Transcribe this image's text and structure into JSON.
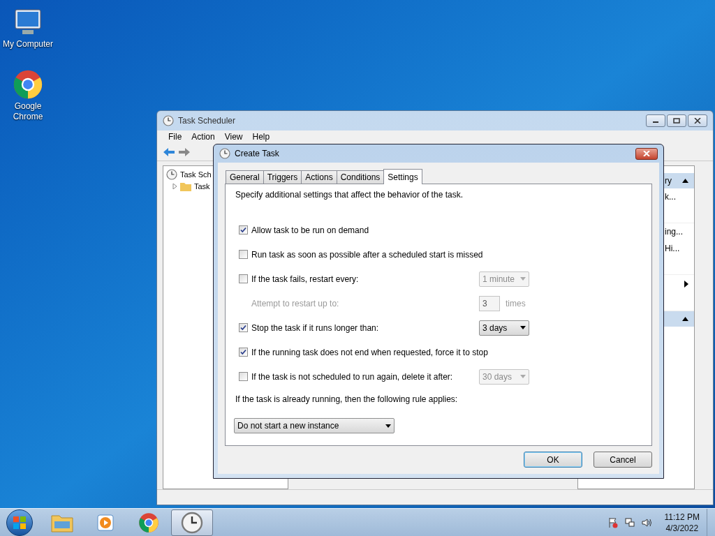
{
  "desktop_icons": [
    {
      "kind": "computer",
      "label": "My Computer"
    },
    {
      "kind": "chrome",
      "label": "Google Chrome"
    }
  ],
  "main_window": {
    "title": "Task Scheduler",
    "menu": [
      "File",
      "Action",
      "View",
      "Help"
    ],
    "tree": [
      {
        "label": "Task Sch",
        "expanded": true,
        "children": [
          {
            "label": "Task",
            "expanded": false
          }
        ]
      }
    ],
    "actions_pane": [
      {
        "kind": "header",
        "label": "ry"
      },
      {
        "kind": "item",
        "label": "k..."
      },
      {
        "kind": "gap"
      },
      {
        "kind": "item",
        "label": "ing..."
      },
      {
        "kind": "item",
        "label": "Hi..."
      },
      {
        "kind": "gap"
      },
      {
        "kind": "submenu"
      },
      {
        "kind": "gap"
      },
      {
        "kind": "header"
      }
    ]
  },
  "dialog": {
    "title": "Create Task",
    "tabs": [
      {
        "label": "General",
        "selected": false
      },
      {
        "label": "Triggers",
        "selected": false
      },
      {
        "label": "Actions",
        "selected": false
      },
      {
        "label": "Conditions",
        "selected": false
      },
      {
        "label": "Settings",
        "selected": true
      }
    ],
    "description": "Specify additional settings that affect the behavior of the task.",
    "rows": [
      {
        "kind": "checkbox",
        "label": "Allow task to be run on demand",
        "checked": true
      },
      {
        "kind": "checkbox",
        "label": "Run task as soon as possible after a scheduled start is missed",
        "checked": false
      },
      {
        "kind": "checkbox",
        "label": "If the task fails, restart every:",
        "checked": false,
        "dropdown": {
          "value": "1 minute",
          "disabled": true
        }
      },
      {
        "kind": "spin",
        "label": "Attempt to restart up to:",
        "value": "3",
        "unit": "times",
        "disabled": true
      },
      {
        "kind": "checkbox",
        "label": "Stop the task if it runs longer than:",
        "checked": true,
        "dropdown": {
          "value": "3 days",
          "disabled": false
        }
      },
      {
        "kind": "checkbox",
        "label": "If the running task does not end when requested, force it to stop",
        "checked": true
      },
      {
        "kind": "checkbox",
        "label": "If the task is not scheduled to run again, delete it after:",
        "checked": false,
        "dropdown": {
          "value": "30 days",
          "disabled": true
        }
      },
      {
        "kind": "text",
        "label": "If the task is already running, then the following rule applies:"
      },
      {
        "kind": "select",
        "value": "Do not start a new instance",
        "disabled": false
      }
    ],
    "buttons": [
      {
        "label": "OK",
        "default": true
      },
      {
        "label": "Cancel",
        "default": false
      }
    ]
  },
  "taskbar": {
    "apps": [
      {
        "kind": "explorer",
        "active": false
      },
      {
        "kind": "media",
        "active": false
      },
      {
        "kind": "chrome",
        "active": false
      },
      {
        "kind": "clock",
        "active": true
      }
    ],
    "time": "11:12 PM",
    "date": "4/3/2022"
  }
}
